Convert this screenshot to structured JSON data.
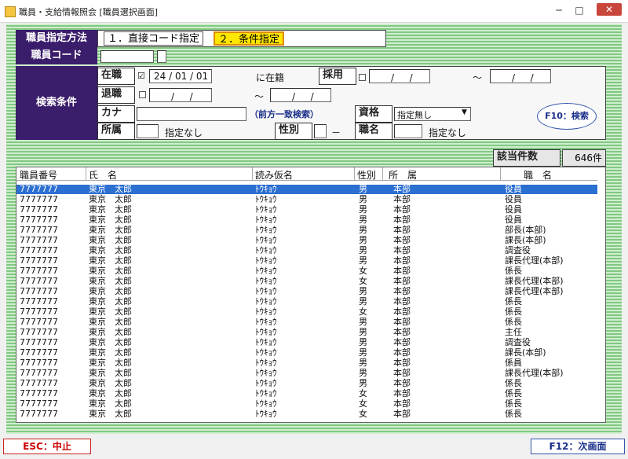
{
  "window": {
    "title": "職員・支給情報照会 [職員選択画面]",
    "minimize": "─",
    "maximize": "□",
    "close": "✕"
  },
  "form": {
    "mode_label": "職員指定方法",
    "mode_opt1": "１．直接コード指定",
    "mode_opt2": "２．条件指定",
    "code_label": "職員コード",
    "search_label": "検索条件",
    "zaishoku_label": "在職",
    "zaishoku_check": "☑",
    "zaishoku_date": "24 / 01 / 01",
    "zaiseki_text": "に在籍",
    "saiyo_label": "採用",
    "date_blank": "/ 　 /",
    "tilde": "～",
    "taishoku_label": "退職",
    "kana_label": "カナ",
    "kana_hint": "（前方一致検索）",
    "shikaku_label": "資格",
    "shikaku_value": "指定無し",
    "shozoku_label": "所属",
    "shozoku_value": "指定なし",
    "seibetsu_label": "性別",
    "seibetsu_value": "－",
    "shokumei_label": "職名",
    "shokumei_value": "指定なし",
    "search_button": "F10：検索"
  },
  "count": {
    "label": "該当件数",
    "value": "646件"
  },
  "table": {
    "headers": [
      "職員番号",
      "氏　名",
      "読み仮名",
      "性別",
      "所　属",
      "職　名"
    ],
    "rows": [
      [
        "7777777",
        "東京　太郎",
        "ﾄｳｷｮｳ",
        "男",
        "本部",
        "役員"
      ],
      [
        "7777777",
        "東京　太郎",
        "ﾄｳｷｮｳ",
        "男",
        "本部",
        "役員"
      ],
      [
        "7777777",
        "東京　太郎",
        "ﾄｳｷｮｳ",
        "男",
        "本部",
        "役員"
      ],
      [
        "7777777",
        "東京　太郎",
        "ﾄｳｷｮｳ",
        "男",
        "本部",
        "役員"
      ],
      [
        "7777777",
        "東京　太郎",
        "ﾄｳｷｮｳ",
        "男",
        "本部",
        "部長(本部)"
      ],
      [
        "7777777",
        "東京　太郎",
        "ﾄｳｷｮｳ",
        "男",
        "本部",
        "課長(本部)"
      ],
      [
        "7777777",
        "東京　太郎",
        "ﾄｳｷｮｳ",
        "男",
        "本部",
        "調査役"
      ],
      [
        "7777777",
        "東京　太郎",
        "ﾄｳｷｮｳ",
        "男",
        "本部",
        "課長代理(本部)"
      ],
      [
        "7777777",
        "東京　太郎",
        "ﾄｳｷｮｳ",
        "女",
        "本部",
        "係長"
      ],
      [
        "7777777",
        "東京　太郎",
        "ﾄｳｷｮｳ",
        "女",
        "本部",
        "課長代理(本部)"
      ],
      [
        "7777777",
        "東京　太郎",
        "ﾄｳｷｮｳ",
        "男",
        "本部",
        "課長代理(本部)"
      ],
      [
        "7777777",
        "東京　太郎",
        "ﾄｳｷｮｳ",
        "男",
        "本部",
        "係長"
      ],
      [
        "7777777",
        "東京　太郎",
        "ﾄｳｷｮｳ",
        "女",
        "本部",
        "係長"
      ],
      [
        "7777777",
        "東京　太郎",
        "ﾄｳｷｮｳ",
        "男",
        "本部",
        "係長"
      ],
      [
        "7777777",
        "東京　太郎",
        "ﾄｳｷｮｳ",
        "男",
        "本部",
        "主任"
      ],
      [
        "7777777",
        "東京　太郎",
        "ﾄｳｷｮｳ",
        "男",
        "本部",
        "調査役"
      ],
      [
        "7777777",
        "東京　太郎",
        "ﾄｳｷｮｳ",
        "男",
        "本部",
        "課長(本部)"
      ],
      [
        "7777777",
        "東京　太郎",
        "ﾄｳｷｮｳ",
        "男",
        "本部",
        "係員"
      ],
      [
        "7777777",
        "東京　太郎",
        "ﾄｳｷｮｳ",
        "男",
        "本部",
        "課長代理(本部)"
      ],
      [
        "7777777",
        "東京　太郎",
        "ﾄｳｷｮｳ",
        "男",
        "本部",
        "係長"
      ],
      [
        "7777777",
        "東京　太郎",
        "ﾄｳｷｮｳ",
        "女",
        "本部",
        "係長"
      ],
      [
        "7777777",
        "東京　太郎",
        "ﾄｳｷｮｳ",
        "女",
        "本部",
        "係長"
      ],
      [
        "7777777",
        "東京　太郎",
        "ﾄｳｷｮｳ",
        "女",
        "本部",
        "係長"
      ]
    ]
  },
  "footer": {
    "esc_label": "ESC：中止",
    "f12_label": "F12：次画面"
  }
}
